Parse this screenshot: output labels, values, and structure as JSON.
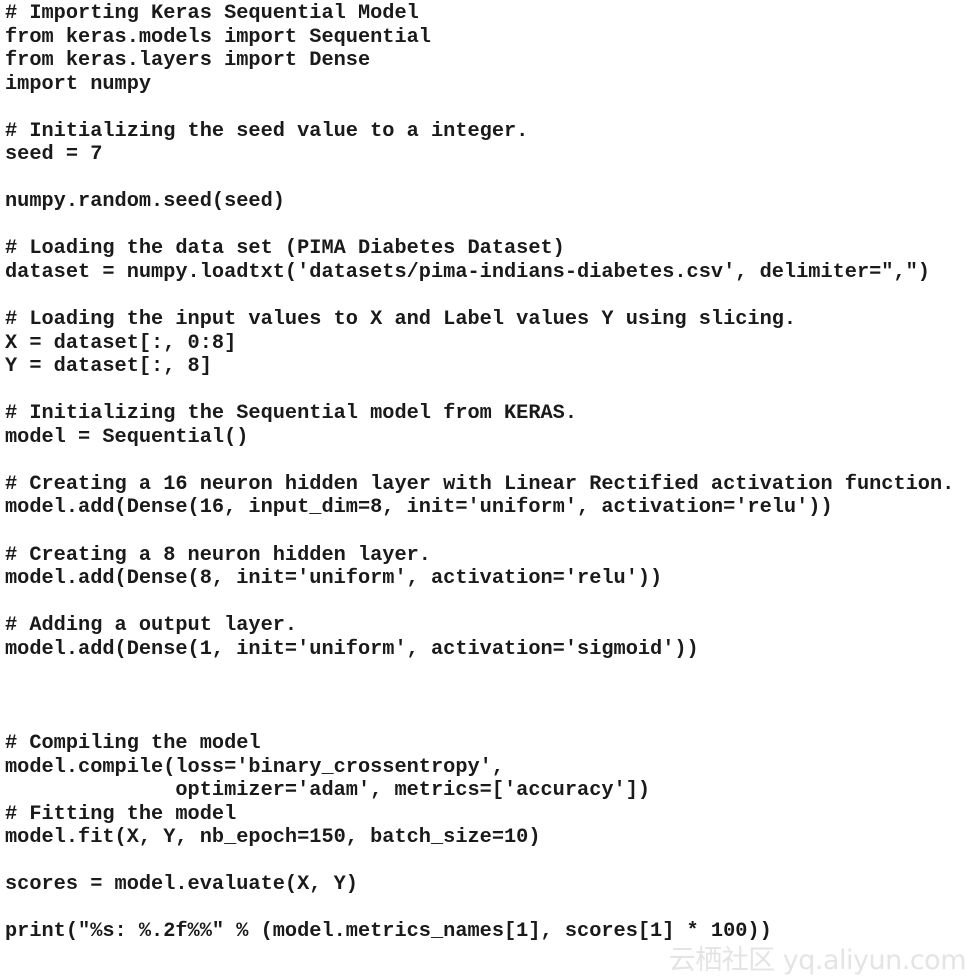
{
  "code_lines": [
    "# Importing Keras Sequential Model",
    "from keras.models import Sequential",
    "from keras.layers import Dense",
    "import numpy",
    "",
    "# Initializing the seed value to a integer.",
    "seed = 7",
    "",
    "numpy.random.seed(seed)",
    "",
    "# Loading the data set (PIMA Diabetes Dataset)",
    "dataset = numpy.loadtxt('datasets/pima-indians-diabetes.csv', delimiter=\",\")",
    "",
    "# Loading the input values to X and Label values Y using slicing.",
    "X = dataset[:, 0:8]",
    "Y = dataset[:, 8]",
    "",
    "# Initializing the Sequential model from KERAS.",
    "model = Sequential()",
    "",
    "# Creating a 16 neuron hidden layer with Linear Rectified activation function.",
    "model.add(Dense(16, input_dim=8, init='uniform', activation='relu'))",
    "",
    "# Creating a 8 neuron hidden layer.",
    "model.add(Dense(8, init='uniform', activation='relu'))",
    "",
    "# Adding a output layer.",
    "model.add(Dense(1, init='uniform', activation='sigmoid'))",
    "",
    "",
    "",
    "# Compiling the model",
    "model.compile(loss='binary_crossentropy',",
    "              optimizer='adam', metrics=['accuracy'])",
    "# Fitting the model",
    "model.fit(X, Y, nb_epoch=150, batch_size=10)",
    "",
    "scores = model.evaluate(X, Y)",
    "",
    "print(\"%s: %.2f%%\" % (model.metrics_names[1], scores[1] * 100))"
  ],
  "watermark": "云栖社区 yq.aliyun.com"
}
